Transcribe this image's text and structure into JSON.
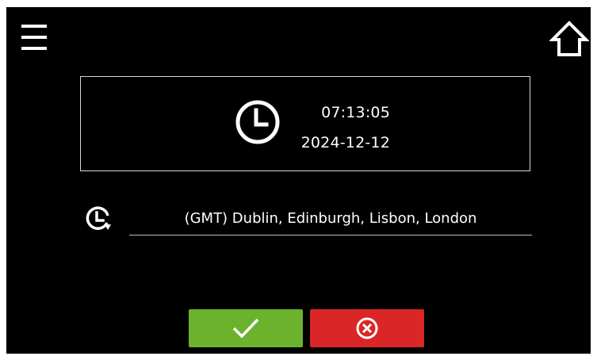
{
  "header": {
    "menu_icon": "hamburger-menu-icon",
    "home_icon": "home-icon"
  },
  "datetime": {
    "icon": "clock-icon",
    "time": "07:13:05",
    "date": "2024-12-12"
  },
  "timezone": {
    "icon": "timezone-icon",
    "value": "(GMT) Dublin, Edinburgh, Lisbon, London"
  },
  "actions": {
    "confirm_icon": "checkmark-icon",
    "cancel_icon": "cancel-circle-x-icon"
  },
  "colors": {
    "background": "#000000",
    "text": "#ffffff",
    "confirm": "#6bb22d",
    "cancel": "#da2626"
  }
}
